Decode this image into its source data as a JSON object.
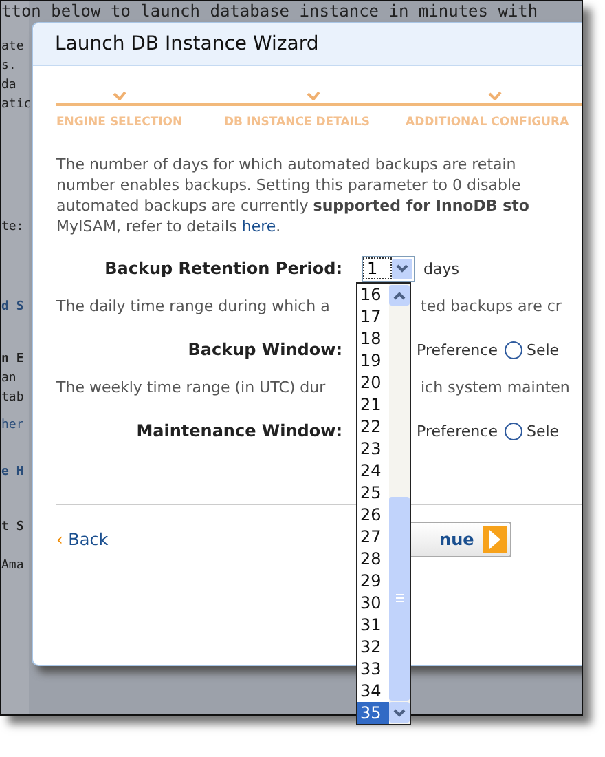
{
  "background_page": {
    "top_line": "tton below to launch database instance in minutes with",
    "fragments": [
      {
        "text": "ate",
        "kind": "text"
      },
      {
        "text": "s.",
        "kind": "text"
      },
      {
        "text": "da",
        "kind": "text"
      },
      {
        "text": "atic",
        "kind": "text"
      },
      {
        "text": "te:",
        "kind": "text"
      },
      {
        "text": "d S",
        "kind": "heading"
      },
      {
        "text": "n E",
        "kind": "bold"
      },
      {
        "text": "an",
        "kind": "text"
      },
      {
        "text": "tab",
        "kind": "text"
      },
      {
        "text": "her",
        "kind": "link"
      },
      {
        "text": "e H",
        "kind": "heading"
      },
      {
        "text": "t S",
        "kind": "bold"
      },
      {
        "text": "Ama",
        "kind": "text"
      }
    ]
  },
  "dialog": {
    "title": "Launch DB Instance Wizard",
    "steps": [
      {
        "label": "ENGINE SELECTION",
        "done": true
      },
      {
        "label": "DB INSTANCE DETAILS",
        "done": true
      },
      {
        "label": "ADDITIONAL CONFIGURA",
        "done": true
      }
    ],
    "intro": {
      "lines": [
        "The number of days for which automated backups are retain",
        "number enables backups. Setting this parameter to 0 disable",
        "automated backups are currently **supported for InnoDB sto**"
      ],
      "last_line": "MyISAM, refer to details ",
      "link": "here",
      "after_link": "."
    },
    "retention": {
      "label": "Backup Retention Period:",
      "value": "1",
      "unit": "days"
    },
    "backup_desc": [
      "The daily time range during which a",
      "ted backups are cr"
    ],
    "backup_window": {
      "label": "Backup Window:",
      "option_1": "Preference",
      "option_2": "Sele",
      "option_2_selected": false
    },
    "maint_desc": [
      "The weekly time range (in UTC) dur",
      "ich system mainten"
    ],
    "maintenance_window": {
      "label": "Maintenance Window:",
      "option_1": "Preference",
      "option_2": "Sele",
      "option_2_selected": false
    },
    "back": {
      "arrow": "‹",
      "label": "Back"
    },
    "continue": {
      "label": "nue"
    }
  },
  "dropdown_list": [
    {
      "label": "16",
      "selected": false
    },
    {
      "label": "17",
      "selected": false
    },
    {
      "label": "18",
      "selected": false
    },
    {
      "label": "19",
      "selected": false
    },
    {
      "label": "20",
      "selected": false
    },
    {
      "label": "21",
      "selected": false
    },
    {
      "label": "22",
      "selected": false
    },
    {
      "label": "23",
      "selected": false
    },
    {
      "label": "24",
      "selected": false
    },
    {
      "label": "25",
      "selected": false
    },
    {
      "label": "26",
      "selected": false
    },
    {
      "label": "27",
      "selected": false
    },
    {
      "label": "28",
      "selected": false
    },
    {
      "label": "29",
      "selected": false
    },
    {
      "label": "30",
      "selected": false
    },
    {
      "label": "31",
      "selected": false
    },
    {
      "label": "32",
      "selected": false
    },
    {
      "label": "33",
      "selected": false
    },
    {
      "label": "34",
      "selected": false
    },
    {
      "label": "35",
      "selected": true
    }
  ]
}
